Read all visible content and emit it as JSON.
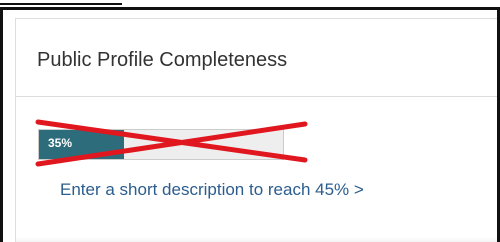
{
  "panel": {
    "title": "Public Profile Completeness"
  },
  "progress": {
    "value_percent": 35,
    "label": "35%",
    "fill_color": "#2d6d7b"
  },
  "overlay": {
    "cross_color": "#e0171e"
  },
  "cta": {
    "label": "Enter a short description to reach 45% >"
  }
}
